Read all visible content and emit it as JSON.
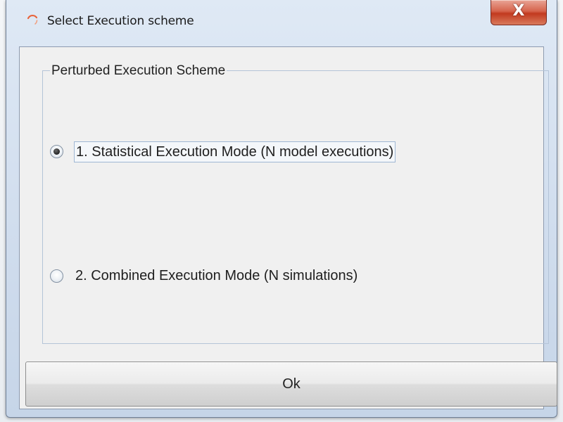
{
  "window": {
    "title": "Select Execution scheme",
    "close_label": "X",
    "icon": "loading-spinner-icon"
  },
  "group": {
    "title": "Perturbed Execution Scheme",
    "options": [
      {
        "label": "1. Statistical Execution Mode (N model executions)",
        "selected": true
      },
      {
        "label": "2. Combined Execution Mode (N simulations)",
        "selected": false
      }
    ]
  },
  "buttons": {
    "ok_label": "Ok"
  },
  "colors": {
    "close_button": "#c23a1f",
    "title_icon": "#e8643c",
    "client_background": "#f0f0f0"
  }
}
